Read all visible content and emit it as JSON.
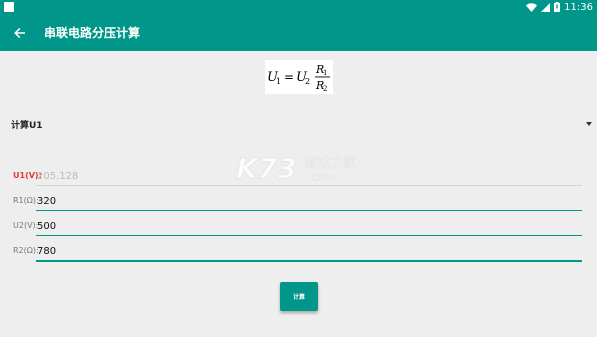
{
  "status_bar": {
    "time": "11:36",
    "icons": [
      "app-notification-icon",
      "wifi-icon",
      "signal-icon",
      "battery-icon"
    ]
  },
  "app_bar": {
    "title": "串联电路分压计算",
    "back_icon": "arrow-back-icon"
  },
  "formula": {
    "lhs": "U",
    "lhs_sub": "1",
    "rhs": "U",
    "rhs_sub": "2",
    "num": "R",
    "num_sub": "1",
    "den": "R",
    "den_sub": "2"
  },
  "mode_select": {
    "selected": "计算U1"
  },
  "fields": [
    {
      "label": "U1(V):",
      "value": "",
      "placeholder": "205.128",
      "highlighted": true
    },
    {
      "label": "R1(Ω):",
      "value": "320",
      "placeholder": ""
    },
    {
      "label": "U2(V):",
      "value": "500",
      "placeholder": ""
    },
    {
      "label": "R2(Ω):",
      "value": "780",
      "placeholder": ""
    }
  ],
  "calculate_button": {
    "label": "计算"
  },
  "watermark": {
    "brand": "K73",
    "text": "游戏之家",
    "domain": ".com"
  },
  "colors": {
    "primary": "#00978a",
    "accent_label": "#e53935",
    "background": "#eeeeee"
  }
}
